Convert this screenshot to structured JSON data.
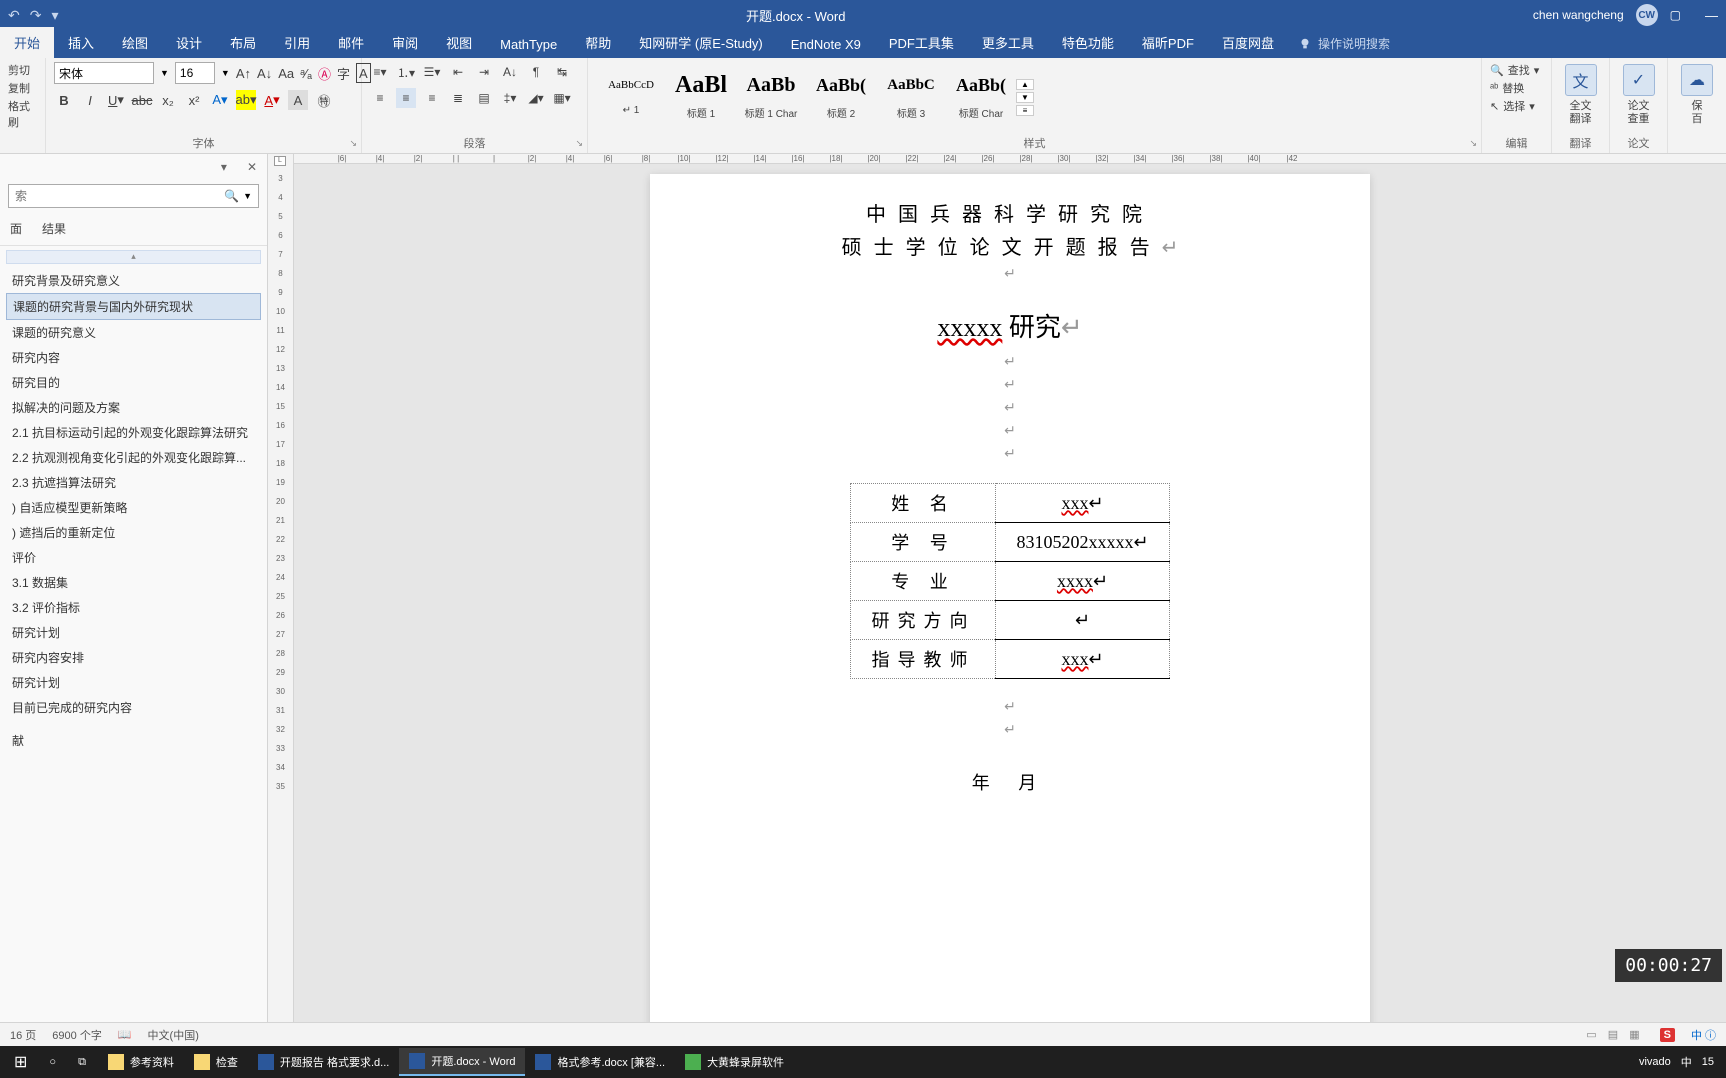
{
  "titlebar": {
    "doc_title": "开题.docx - Word",
    "user": "chen wangcheng",
    "avatar": "CW"
  },
  "tabs": [
    "开始",
    "插入",
    "绘图",
    "设计",
    "布局",
    "引用",
    "邮件",
    "审阅",
    "视图",
    "MathType",
    "帮助",
    "知网研学 (原E-Study)",
    "EndNote X9",
    "PDF工具集",
    "更多工具",
    "特色功能",
    "福昕PDF",
    "百度网盘"
  ],
  "tell_me": "操作说明搜索",
  "ribbon": {
    "clipboard": {
      "cut": "剪切",
      "copy": "复制",
      "painter": "格式刷",
      "label": ""
    },
    "font": {
      "name": "宋体",
      "size": "16",
      "label": "字体"
    },
    "para": {
      "label": "段落"
    },
    "styles": {
      "label": "样式",
      "items": [
        {
          "preview": "AaBbCcD",
          "name": "↵ 1"
        },
        {
          "preview": "AaBl",
          "name": "标题 1"
        },
        {
          "preview": "AaBb",
          "name": "标题 1 Char"
        },
        {
          "preview": "AaBb(",
          "name": "标题 2"
        },
        {
          "preview": "AaBbC",
          "name": "标题 3"
        },
        {
          "preview": "AaBb(",
          "name": "标题 Char"
        }
      ]
    },
    "edit": {
      "find": "查找",
      "replace": "替换",
      "select": "选择",
      "label": "编辑"
    },
    "misc": [
      {
        "l1": "全文",
        "l2": "翻译",
        "group": "翻译"
      },
      {
        "l1": "论文",
        "l2": "查重",
        "group": "论文"
      },
      {
        "l1": "保",
        "l2": "百",
        "group": ""
      }
    ]
  },
  "nav": {
    "search_ph": "索",
    "tabs": [
      "面",
      "结果"
    ],
    "items": [
      "研究背景及研究意义",
      "课题的研究背景与国内外研究现状",
      "课题的研究意义",
      "研究内容",
      "研究目的",
      "拟解决的问题及方案",
      "2.1 抗目标运动引起的外观变化跟踪算法研究",
      "2.2 抗观测视角变化引起的外观变化跟踪算...",
      "2.3 抗遮挡算法研究",
      ") 自适应模型更新策略",
      ") 遮挡后的重新定位",
      "评价",
      "3.1 数据集",
      "3.2 评价指标",
      "研究计划",
      "研究内容安排",
      "研究计划",
      "目前已完成的研究内容",
      "",
      "献"
    ],
    "selected_index": 1
  },
  "doc": {
    "institute": "中国兵器科学研究院",
    "subtitle": "硕士学位论文开题报告",
    "title_prefix": "xxxxx",
    "title_suffix": " 研究",
    "rows": [
      {
        "label": "姓    名",
        "value": "xxx"
      },
      {
        "label": "学    号",
        "value": "83105202xxxxx"
      },
      {
        "label": "专    业",
        "value": "xxxx"
      },
      {
        "label": "研究方向",
        "value": ""
      },
      {
        "label": "指导教师",
        "value": "xxx"
      }
    ],
    "date": "年    月"
  },
  "timer": "00:00:27",
  "status": {
    "page": "16 页",
    "words": "6900 个字",
    "lang": "中文(中国)"
  },
  "taskbar": {
    "items": [
      {
        "icon": "folder",
        "label": "参考资料"
      },
      {
        "icon": "folder",
        "label": "检查"
      },
      {
        "icon": "word",
        "label": "开题报告 格式要求.d..."
      },
      {
        "icon": "word",
        "label": "开题.docx - Word",
        "active": true
      },
      {
        "icon": "word",
        "label": "格式参考.docx [兼容..."
      },
      {
        "icon": "green",
        "label": "大黄蜂录屏软件"
      }
    ],
    "tray": [
      "vivado",
      "中",
      "15"
    ]
  },
  "hruler_ticks": [
    "|6|",
    "|4|",
    "|2|",
    "| |",
    "|",
    "|2|",
    "|4|",
    "|6|",
    "|8|",
    "|10|",
    "|12|",
    "|14|",
    "|16|",
    "|18|",
    "|20|",
    "|22|",
    "|24|",
    "|26|",
    "|28|",
    "|30|",
    "|32|",
    "|34|",
    "|36|",
    "|38|",
    "|40|",
    "|42"
  ],
  "vruler_ticks": [
    "3",
    "4",
    "5",
    "6",
    "7",
    "8",
    "9",
    "10",
    "11",
    "12",
    "13",
    "14",
    "15",
    "16",
    "17",
    "18",
    "19",
    "20",
    "21",
    "22",
    "23",
    "24",
    "25",
    "26",
    "27",
    "28",
    "29",
    "30",
    "31",
    "32",
    "33",
    "34",
    "35"
  ]
}
